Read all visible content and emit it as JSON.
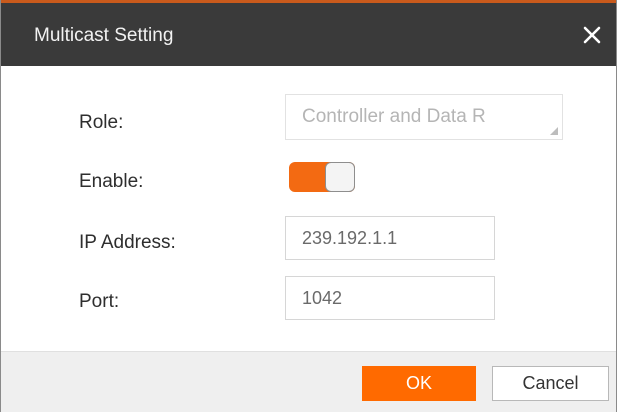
{
  "dialog": {
    "title": "Multicast Setting",
    "close_icon": "close-icon",
    "accent_color": "#ff6a00",
    "titlebar_color": "#3a3a3a"
  },
  "form": {
    "role": {
      "label": "Role:",
      "value": "Controller and Data R"
    },
    "enable": {
      "label": "Enable:",
      "state": "on"
    },
    "ip_address": {
      "label": "IP Address:",
      "value": "239.192.1.1"
    },
    "port": {
      "label": "Port:",
      "value": "1042"
    }
  },
  "footer": {
    "ok_label": "OK",
    "cancel_label": "Cancel"
  }
}
